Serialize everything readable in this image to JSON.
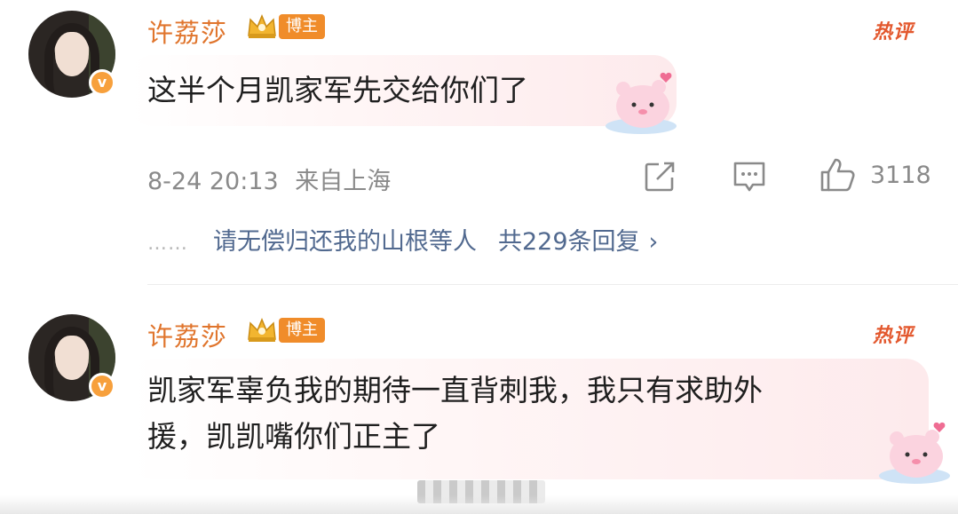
{
  "comments": [
    {
      "username": "许荔莎",
      "badge": "博主",
      "hot_label": "热评",
      "verified_icon": "v-badge-icon",
      "text": "这半个月凯家军先交给你们了",
      "date": "8-24 20:13",
      "location": "来自上海",
      "likes": "3118",
      "replies_preview": "请无偿归还我的山根等人",
      "replies_count": "共229条回复",
      "dots": "……"
    },
    {
      "username": "许荔莎",
      "badge": "博主",
      "hot_label": "热评",
      "verified_icon": "v-badge-icon",
      "text_line1": "凯家军辜负我的期待一直背刺我，我只有求助外",
      "text_line2": "援，凯凯嘴你们正主了"
    }
  ],
  "colors": {
    "username": "#e0752d",
    "badge": "#f08c2a",
    "hot": "#e3582e",
    "reply_link": "#51698f",
    "meta": "#8a8a8a"
  }
}
